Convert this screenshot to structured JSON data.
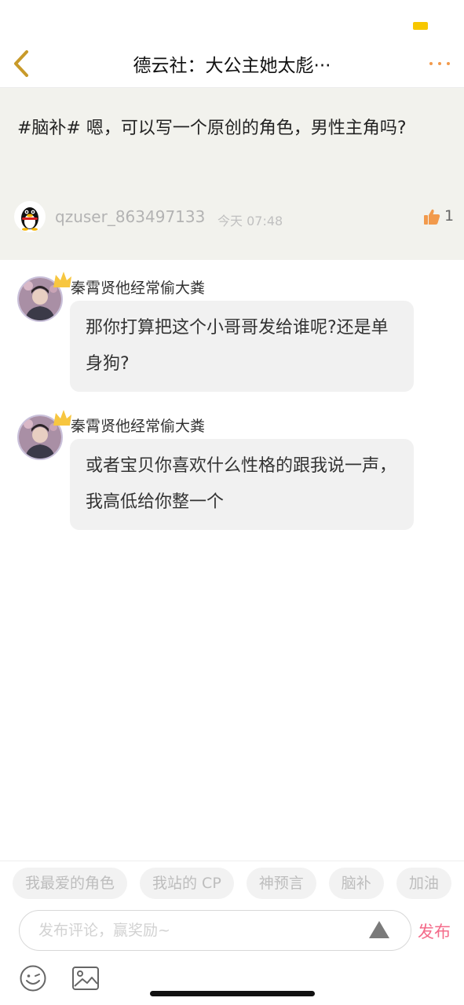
{
  "nav": {
    "title": "德云社：大公主她太彪···"
  },
  "post": {
    "text": "#脑补# 嗯，可以写一个原创的角色，男性主角吗?",
    "username": "qzuser_863497133",
    "time": "今天 07:48",
    "likes": "1"
  },
  "comments": [
    {
      "name": "秦霄贤他经常偷大粪",
      "text": "那你打算把这个小哥哥发给谁呢?还是单身狗?"
    },
    {
      "name": "秦霄贤他经常偷大粪",
      "text": "或者宝贝你喜欢什么性格的跟我说一声，我高低给你整一个"
    }
  ],
  "tags": [
    "我最爱的角色",
    "我站的 CP",
    "神预言",
    "脑补",
    "加油"
  ],
  "composer": {
    "placeholder": "发布评论，赢奖励~",
    "publish_label": "发布"
  },
  "colors": {
    "accent_orange": "#f29a4c",
    "publish_pink": "#f46b8a",
    "battery_yellow": "#f7c700"
  },
  "icons": {
    "back": "chevron-left-icon",
    "more": "more-dots-icon",
    "like": "thumbs-up-icon",
    "crown": "crown-icon",
    "mount": "mountain-icon",
    "emoji": "smile-icon",
    "image": "image-icon"
  }
}
